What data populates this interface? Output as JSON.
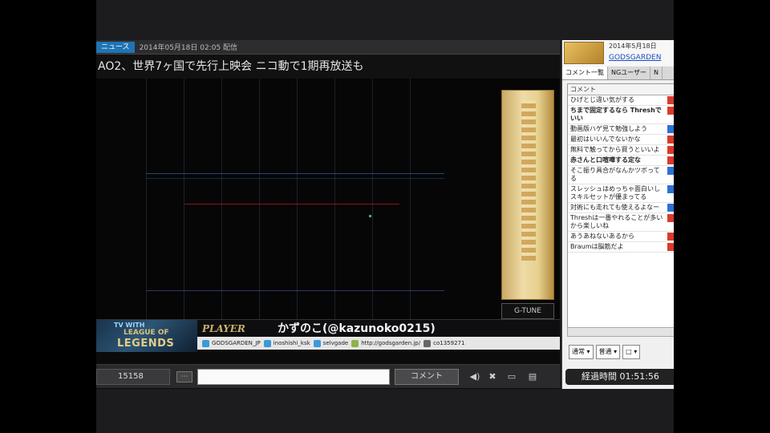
{
  "news": {
    "tag": "ニュース",
    "date": "2014年05月18日 02:05 配信",
    "headline": "AO2、世界7ヶ国で先行上映会 ニコ動で1期再放送も"
  },
  "ads": {
    "gtune": "G-TUNE",
    "lol_line1": "TV WITH",
    "lol_line2": "LEAGUE OF",
    "lol_line3": "LEGENDS",
    "player_label": "PLAYER",
    "player_name": "かずのこ(@kazunoko0215)",
    "links": [
      "GODSGARDEN_JP",
      "inoshishi_ksk",
      "selvgade",
      "http://godsgarden.jp/",
      "co1359271"
    ]
  },
  "controls": {
    "time": "15158",
    "comment_placeholder": "",
    "comment_button": "コメント"
  },
  "side": {
    "date": "2014年5月18日",
    "channel_link": "GODSGARDEN",
    "tabs": [
      "コメント一覧",
      "NGユーザー",
      "N"
    ],
    "list_header": "コメント",
    "comments": [
      {
        "text": "ひげとじ違い気がする",
        "bold": false,
        "mark": "red"
      },
      {
        "text": "ちまで固定するなら Threshでいい",
        "bold": true,
        "mark": "red"
      },
      {
        "text": "動画版ハゲ見て勉強しよう",
        "bold": false,
        "mark": "blue"
      },
      {
        "text": "最初はいいんでないかな",
        "bold": false,
        "mark": "red"
      },
      {
        "text": "無料で触ってから買うといいよ",
        "bold": false,
        "mark": "red"
      },
      {
        "text": "赤さんと口喧嘩する定な",
        "bold": true,
        "mark": "red"
      },
      {
        "text": "そこ振り具合がなんかツボってる",
        "bold": false,
        "mark": "blue"
      },
      {
        "text": "スレッシュはめっちゃ面白いしスキルセットが優まってる",
        "bold": false,
        "mark": "blue"
      },
      {
        "text": "対術にも走れても使えるよなー",
        "bold": false,
        "mark": "blue"
      },
      {
        "text": "Threshは一番やれることが多いから楽しいね",
        "bold": false,
        "mark": "red"
      },
      {
        "text": "あうあねないあるから",
        "bold": false,
        "mark": "red"
      },
      {
        "text": "Braumは脳筋だよ",
        "bold": false,
        "mark": "red"
      }
    ],
    "select1": "通常",
    "select2": "普通",
    "select3": "□",
    "elapsed": "経過時間 01:51:56"
  }
}
